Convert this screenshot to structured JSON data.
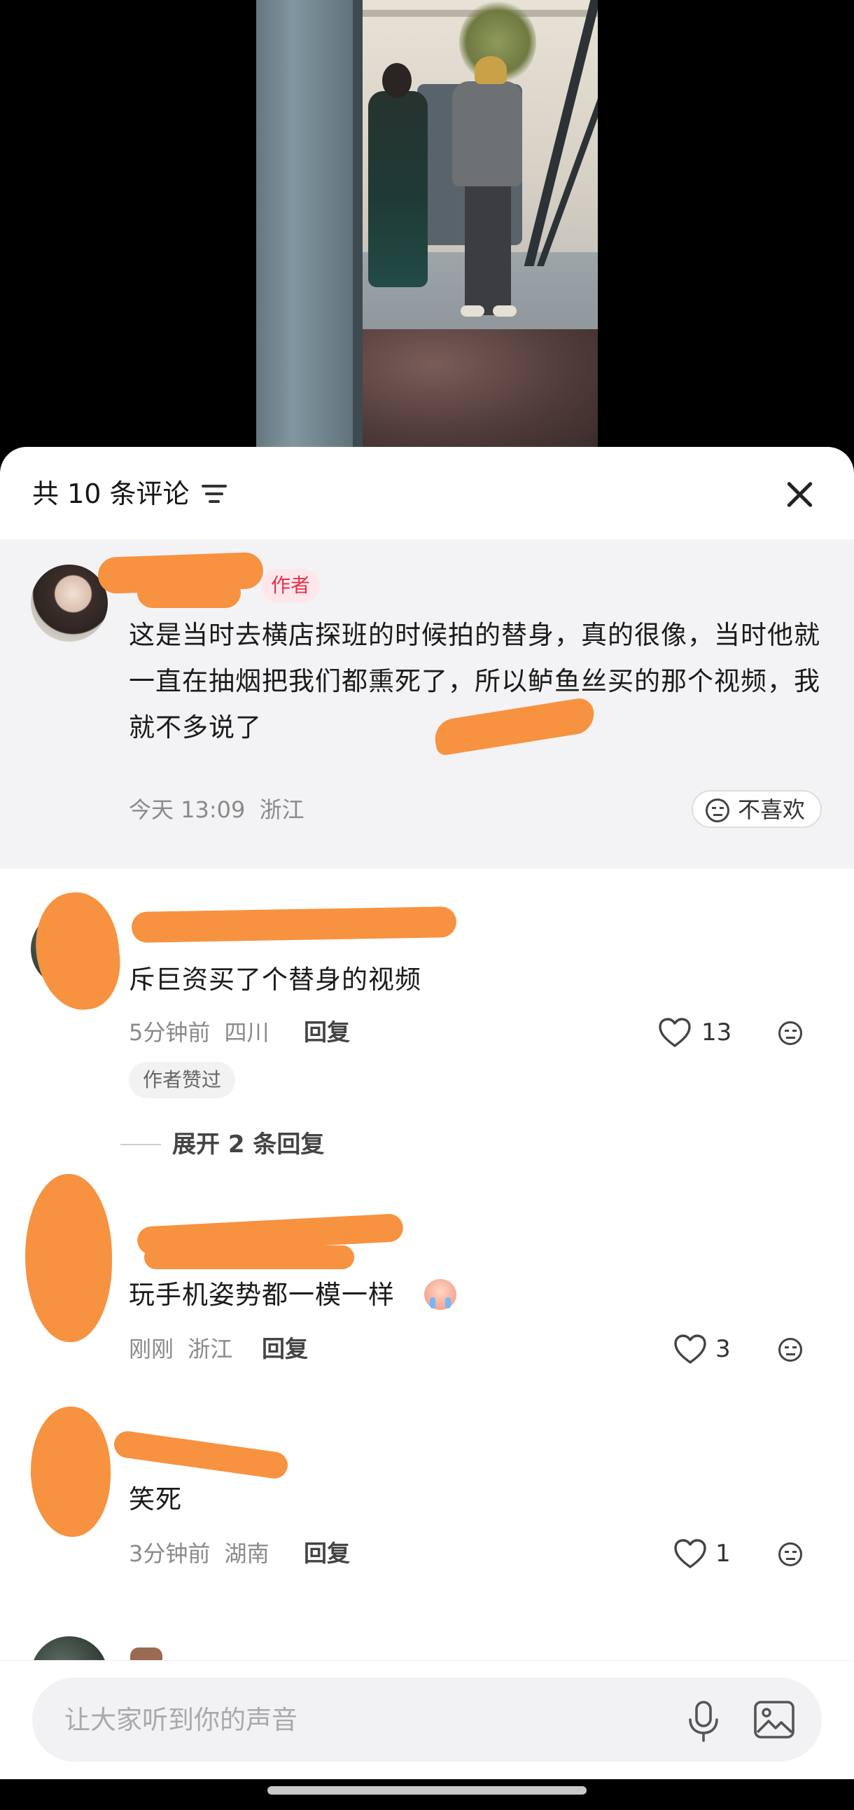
{
  "header": {
    "comment_count_label": "共 10 条评论"
  },
  "icons": {
    "filter": "filter-icon",
    "close": "close-icon",
    "dislike": "neutral-face-icon",
    "like": "heart-outline-icon",
    "mic": "microphone-icon",
    "image": "image-icon"
  },
  "pinned_comment": {
    "badge": "作者",
    "text": "这是当时去横店探班的时候拍的替身，真的很像，当时他就一直在抽烟把我们都熏死了，所以鲈鱼丝买的那个视频，我就不多说了",
    "time": "今天 13:09",
    "location": "浙江",
    "dislike_label": "不喜欢"
  },
  "comments": [
    {
      "text": "斥巨资买了个替身的视频",
      "time": "5分钟前",
      "location": "四川",
      "reply_label": "回复",
      "likes": "13",
      "author_liked_tag": "作者赞过",
      "expand_replies_label": "展开 2 条回复"
    },
    {
      "text": "玩手机姿势都一模一样",
      "time": "刚刚",
      "location": "浙江",
      "reply_label": "回复",
      "likes": "3"
    },
    {
      "text": "笑死",
      "time": "3分钟前",
      "location": "湖南",
      "reply_label": "回复",
      "likes": "1"
    }
  ],
  "input": {
    "placeholder": "让大家听到你的声音"
  },
  "colors": {
    "sheet_bg": "#ffffff",
    "pinned_bg": "#f3f3f5",
    "author_badge_text": "#e0344e",
    "author_badge_bg": "#fde7ea",
    "redaction": "#f79240"
  }
}
